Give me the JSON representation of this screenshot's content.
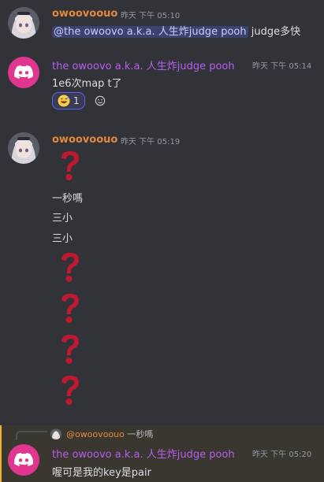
{
  "messages": [
    {
      "author": "owoovoouo",
      "timestamp": "昨天 下午 05:10",
      "mention": "@the owoovo a.k.a. 人生炸judge pooh",
      "text_after_mention": " judge多快"
    },
    {
      "author": "the owoovo a.k.a. 人生炸judge pooh",
      "timestamp": "昨天 下午 05:14",
      "text": "1e6次map t了",
      "reactions": [
        {
          "emoji": "sweat-smile",
          "count": "1"
        }
      ]
    },
    {
      "author": "owoovoouo",
      "timestamp": "昨天 下午 05:19",
      "lines": [
        "一秒嗎",
        "三小",
        "三小"
      ]
    },
    {
      "reply": {
        "author": "@owoovoouo",
        "content": "一秒嗎"
      },
      "author": "the owoovo a.k.a. 人生炸judge pooh",
      "timestamp": "昨天 下午 05:20",
      "text": "喔可是我的key是pair"
    }
  ],
  "colors": {
    "background": "#313338",
    "owoovoouo_name": "#e58a3c",
    "pooh_name": "#b85ef0",
    "question_mark": "#be1931",
    "mention_bg": "#3c4270",
    "highlight_bg": "#3a3630"
  }
}
